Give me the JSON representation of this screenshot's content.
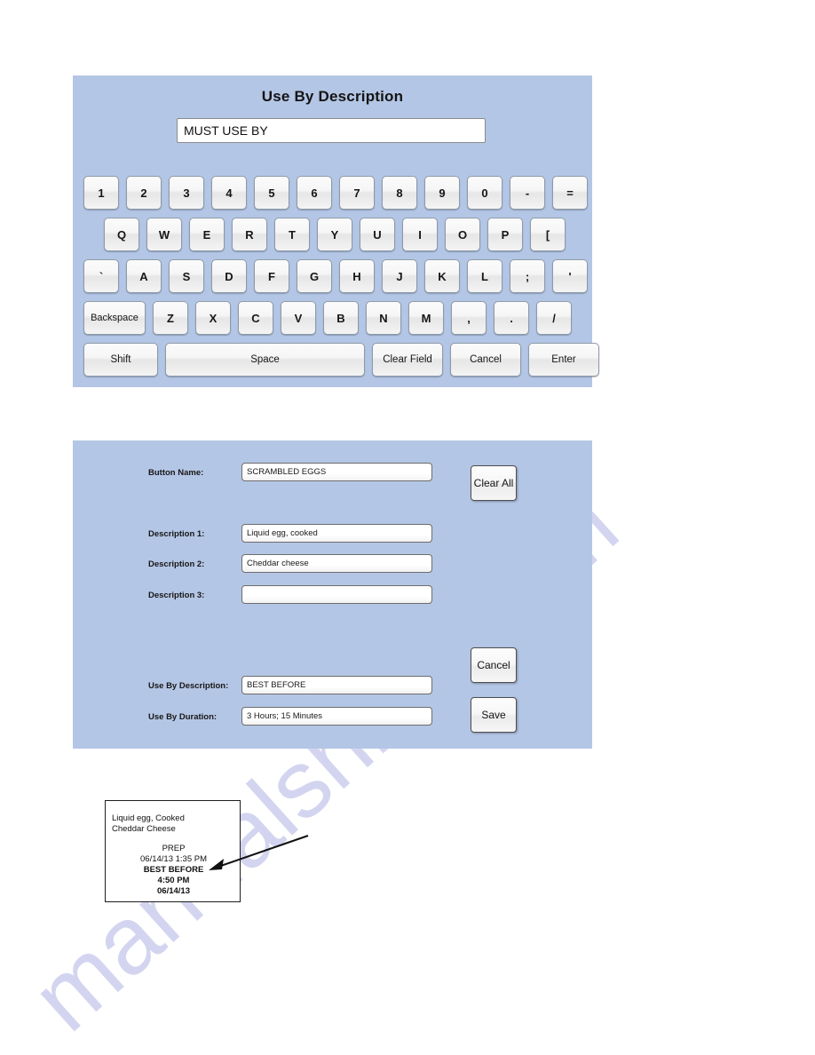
{
  "watermark": {
    "text": "manualshive.com"
  },
  "keyboard_panel": {
    "title": "Use By Description",
    "input": {
      "value": "MUST USE BY",
      "placeholder": ""
    },
    "rows": {
      "numbers": [
        "1",
        "2",
        "3",
        "4",
        "5",
        "6",
        "7",
        "8",
        "9",
        "0",
        "-",
        "="
      ],
      "qwerty": [
        "Q",
        "W",
        "E",
        "R",
        "T",
        "Y",
        "U",
        "I",
        "O",
        "P",
        "["
      ],
      "home": [
        "`",
        "A",
        "S",
        "D",
        "F",
        "G",
        "H",
        "J",
        "K",
        "L",
        ";",
        "'"
      ],
      "bottom": [
        "Backspace",
        "Z",
        "X",
        "C",
        "V",
        "B",
        "N",
        "M",
        ",",
        ".",
        "/"
      ],
      "control": [
        "Shift",
        "Space",
        "Clear Field",
        "Cancel",
        "Enter"
      ]
    }
  },
  "form_panel": {
    "labels": {
      "button_name": "Button Name:",
      "description1": "Description 1:",
      "description2": "Description 2:",
      "description3": "Description 3:",
      "useby_description": "Use By Description:",
      "useby_duration": "Use By Duration:"
    },
    "values": {
      "button_name": "SCRAMBLED EGGS",
      "description1": "Liquid egg, cooked",
      "description2": "Cheddar cheese",
      "description3": "",
      "useby_description": "BEST BEFORE",
      "useby_duration": "3 Hours; 15 Minutes"
    },
    "buttons": {
      "clear_all": "Clear All",
      "cancel": "Cancel",
      "save": "Save"
    }
  },
  "receipt_label": {
    "line1": "Liquid egg, Cooked",
    "line2": "Cheddar Cheese",
    "prep_label": "PREP",
    "prep_datetime": "06/14/13    1:35 PM",
    "useby_label": "BEST BEFORE",
    "useby_time": "4:50 PM",
    "useby_date": "06/14/13"
  },
  "colors": {
    "panel_background": "#b4c6e5",
    "key_face": "#f4f4f4",
    "key_border": "#8e9aa8",
    "text": "#141414",
    "watermark": "#b9bce8"
  }
}
